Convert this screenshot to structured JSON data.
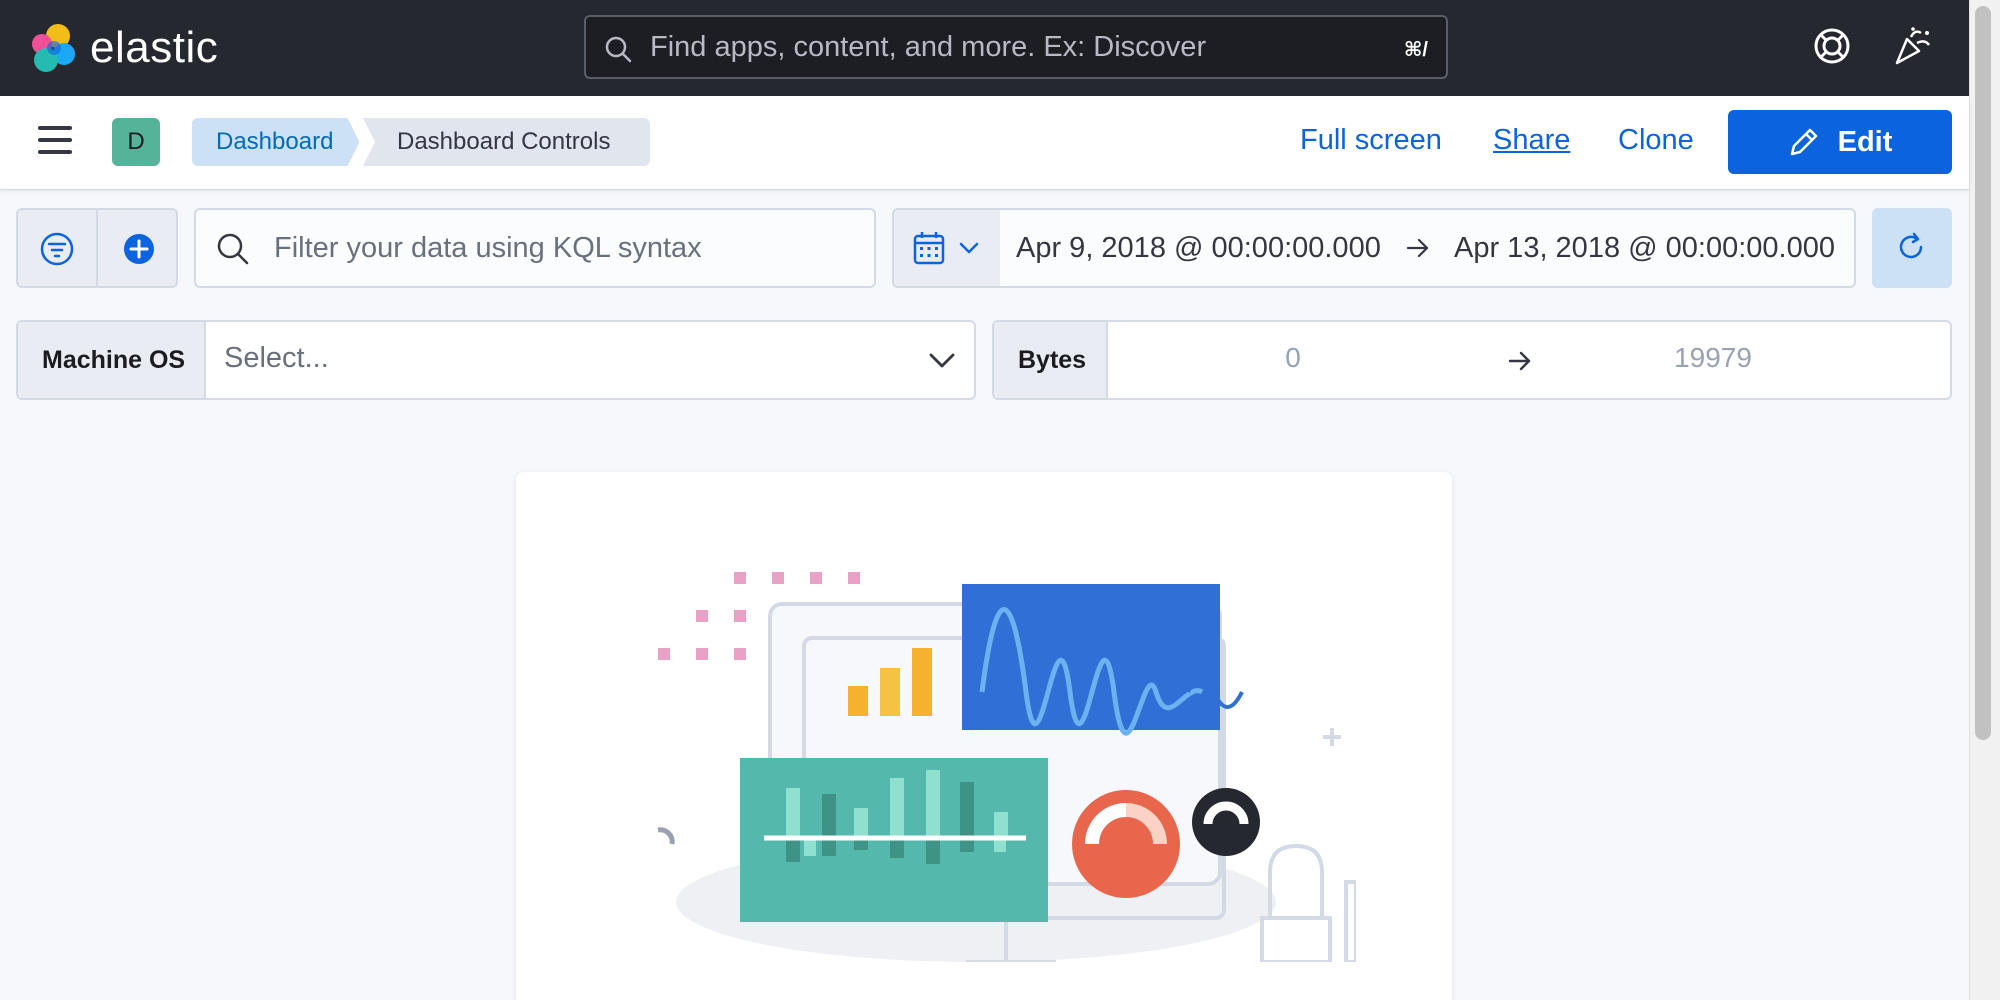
{
  "header": {
    "logo_text": "elastic",
    "search_placeholder": "Find apps, content, and more. Ex: Discover",
    "search_shortcut": "⌘/",
    "icons": [
      "elastic-logo-icon",
      "search-icon",
      "help-icon",
      "newsfeed-icon"
    ]
  },
  "nav": {
    "space_initial": "D",
    "breadcrumbs": [
      "Dashboard",
      "Dashboard Controls"
    ],
    "full_screen": "Full screen",
    "share": "Share",
    "clone": "Clone",
    "edit": "Edit",
    "icons": [
      "hamburger-menu-icon",
      "pencil-icon"
    ]
  },
  "query_bar": {
    "kql_placeholder": "Filter your data using KQL syntax",
    "date_start": "Apr 9, 2018 @ 00:00:00.000",
    "date_end": "Apr 13, 2018 @ 00:00:00.000",
    "icons": [
      "filter-icon",
      "add-filter-icon",
      "search-icon",
      "calendar-icon",
      "chevron-down-icon",
      "arrow-right-icon",
      "refresh-icon"
    ]
  },
  "controls": {
    "machine_os_label": "Machine OS",
    "machine_os_placeholder": "Select...",
    "bytes_label": "Bytes",
    "bytes_min": "0",
    "bytes_max": "19979"
  },
  "colors": {
    "header_bg": "#25282f",
    "primary": "#0b64dd",
    "breadcrumb_active_bg": "#cce1f5",
    "avatar_bg": "#54b399"
  }
}
